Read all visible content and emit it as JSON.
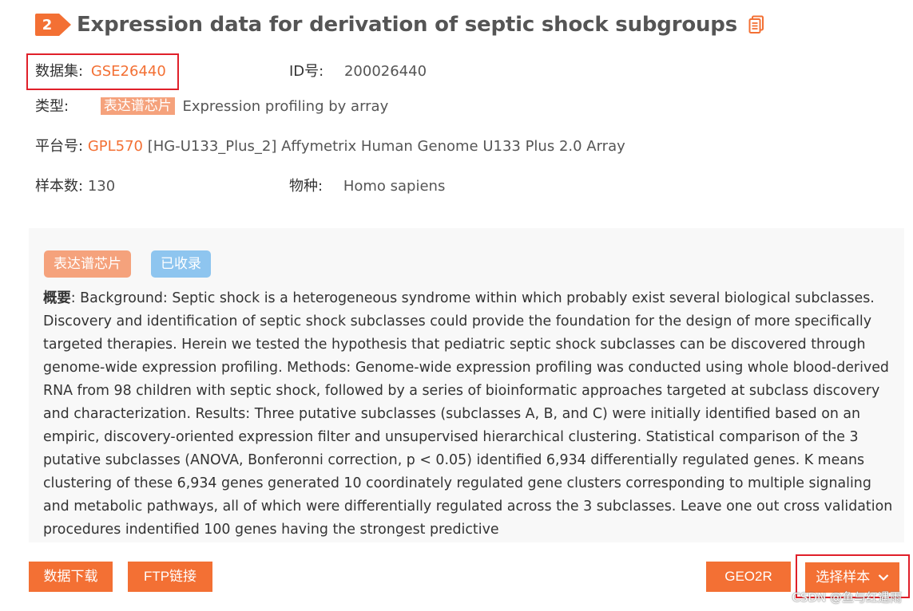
{
  "header": {
    "section_number": "2",
    "title": "Expression data for derivation of septic shock subgroups",
    "copy_icon": "document-copy-icon"
  },
  "meta": {
    "dataset_label": "数据集:",
    "dataset_value": "GSE26440",
    "id_label": "ID号:",
    "id_value": "200026440",
    "type_label": "类型:",
    "type_tag": "表达谱芯片",
    "type_value": "Expression profiling by array",
    "platform_label": "平台号:",
    "platform_link": "GPL570",
    "platform_value": "[HG-U133_Plus_2] Affymetrix Human Genome U133 Plus 2.0 Array",
    "samples_label": "样本数:",
    "samples_value": "130",
    "species_label": "物种:",
    "species_value": "Homo sapiens"
  },
  "panel": {
    "tag_type": "表达谱芯片",
    "tag_status": "已收录",
    "summary_label": "概要",
    "summary_text": ": Background: Septic shock is a heterogeneous syndrome within which probably exist several biological subclasses. Discovery and identification of septic shock subclasses could provide the foundation for the design of more specifically targeted therapies. Herein we tested the hypothesis that pediatric septic shock subclasses can be discovered through genome-wide expression profiling. Methods: Genome-wide expression profiling was conducted using whole blood-derived RNA from 98 children with septic shock, followed by a series of bioinformatic approaches targeted at subclass discovery and characterization. Results: Three putative subclasses (subclasses A, B, and C) were initially identified based on an empiric, discovery-oriented expression filter and unsupervised hierarchical clustering. Statistical comparison of the 3 putative subclasses (ANOVA, Bonferonni correction, p < 0.05) identified 6,934 differentially regulated genes. K means clustering of these 6,934 genes generated 10 coordinately regulated gene clusters corresponding to multiple signaling and metabolic pathways, all of which were differentially regulated across the 3 subclasses. Leave one out cross validation procedures indentified 100 genes having the strongest predictive"
  },
  "actions": {
    "download_label": "数据下载",
    "ftp_label": "FTP链接",
    "geo2r_label": "GEO2R",
    "select_samples_label": "选择样本",
    "chevron_icon": "chevron-down-icon"
  },
  "watermark": "CSDN @鱼与红遇雨",
  "colors": {
    "accent": "#f37034",
    "tag_orange": "#f5a27c",
    "tag_blue": "#8ec5ef",
    "highlight_box": "#e0202a",
    "panel_bg": "#f8f8f8"
  }
}
